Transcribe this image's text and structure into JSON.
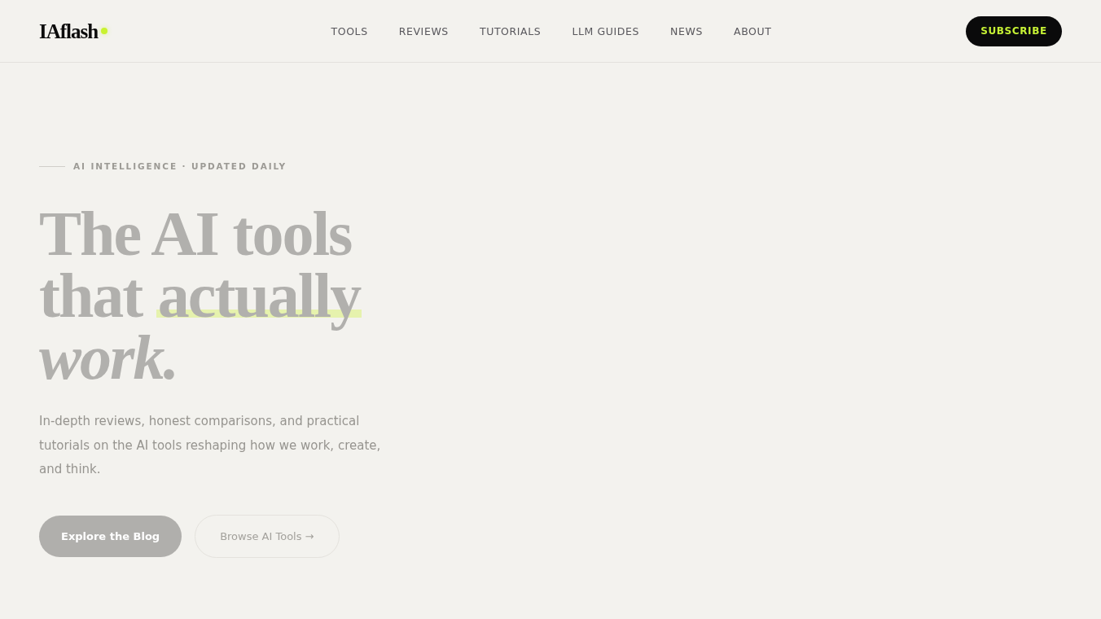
{
  "header": {
    "logo": "IAflash",
    "nav": [
      {
        "label": "TOOLS"
      },
      {
        "label": "REVIEWS"
      },
      {
        "label": "TUTORIALS"
      },
      {
        "label": "LLM GUIDES"
      },
      {
        "label": "NEWS"
      },
      {
        "label": "ABOUT"
      }
    ],
    "subscribe_button": "SUBSCRIBE"
  },
  "hero": {
    "eyebrow": "AI INTELLIGENCE · UPDATED DAILY",
    "headline": [
      {
        "segments": [
          {
            "text": "The AI tools",
            "kind": "plain"
          }
        ]
      },
      {
        "segments": [
          {
            "text": "that ",
            "kind": "plain"
          },
          {
            "text": "actually",
            "kind": "highlight"
          }
        ]
      },
      {
        "segments": [
          {
            "text": "work.",
            "kind": "italic"
          }
        ]
      }
    ],
    "description": "In-depth reviews, honest comparisons, and practical tutorials on the AI tools reshaping how we work, create, and think.",
    "buttons": [
      {
        "label": "Explore the Blog",
        "kind": "primary"
      },
      {
        "label": "Browse AI Tools →",
        "kind": "outline"
      }
    ]
  }
}
